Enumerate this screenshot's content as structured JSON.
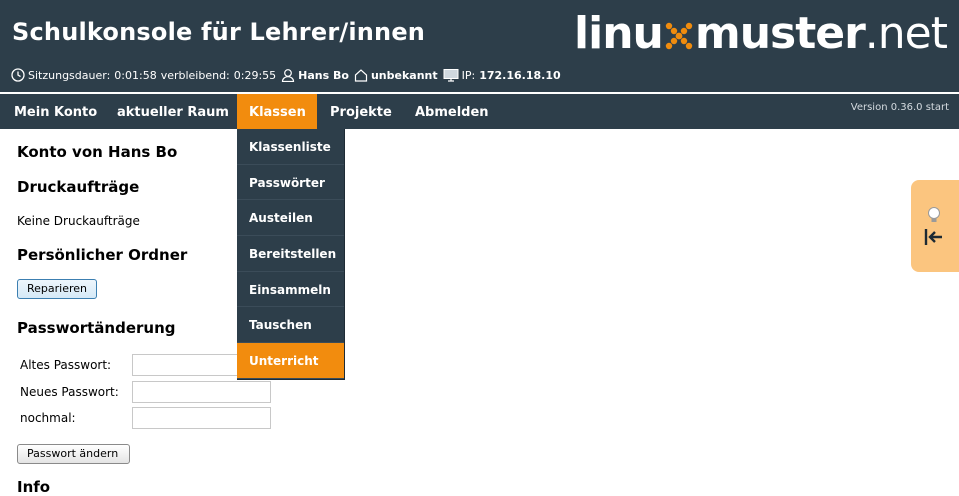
{
  "header": {
    "title": "Schulkonsole für Lehrer/innen",
    "logo": {
      "part1": "linu",
      "part2": "muster",
      "part3": ".net"
    },
    "status": {
      "session_label": "Sitzungsdauer:",
      "session_value": "0:01:58",
      "remaining_label": "verbleibend:",
      "remaining_value": "0:29:55",
      "user": "Hans Bo",
      "room": "unbekannt",
      "ip_label": "IP:",
      "ip_value": "172.16.18.10"
    }
  },
  "nav": {
    "items": [
      "Mein Konto",
      "aktueller Raum",
      "Klassen",
      "Projekte",
      "Abmelden"
    ],
    "active": "Klassen",
    "version": "Version 0.36.0 start"
  },
  "dropdown": {
    "items": [
      "Klassenliste",
      "Passwörter",
      "Austeilen",
      "Bereitstellen",
      "Einsammeln",
      "Tauschen",
      "Unterricht"
    ],
    "active": "Unterricht"
  },
  "content": {
    "account_heading": "Konto von Hans Bo",
    "print_heading": "Druckaufträge",
    "print_empty": "Keine Druckaufträge",
    "folder_heading": "Persönlicher Ordner",
    "repair_button": "Reparieren",
    "password_heading": "Passwortänderung",
    "old_password_label": "Altes Passwort:",
    "new_password_label": "Neues Passwort:",
    "repeat_label": "nochmal:",
    "change_button": "Passwort ändern",
    "next_heading": "Info"
  },
  "colors": {
    "header_bg": "#2d3e4a",
    "accent": "#f28c0e",
    "sidetab": "#fbc57f"
  }
}
